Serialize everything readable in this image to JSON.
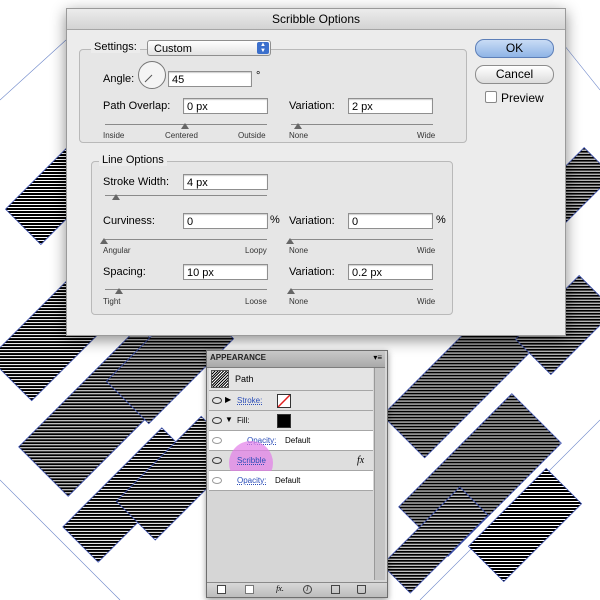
{
  "dialog": {
    "title": "Scribble Options",
    "settings_label": "Settings:",
    "settings_value": "Custom",
    "angle_label": "Angle:",
    "angle_value": "45",
    "angle_unit": "°",
    "path_overlap_label": "Path Overlap:",
    "path_overlap_value": "0 px",
    "path_overlap_variation_label": "Variation:",
    "path_overlap_variation_value": "2 px",
    "path_overlap_ticks": [
      "Inside",
      "Centered",
      "Outside"
    ],
    "path_overlap_variation_ticks": [
      "None",
      "Wide"
    ],
    "line_options_title": "Line Options",
    "stroke_width_label": "Stroke Width:",
    "stroke_width_value": "4 px",
    "curviness_label": "Curviness:",
    "curviness_value": "0",
    "curviness_unit": "%",
    "curviness_ticks": [
      "Angular",
      "Loopy"
    ],
    "curviness_variation_label": "Variation:",
    "curviness_variation_value": "0",
    "curviness_variation_unit": "%",
    "curviness_variation_ticks": [
      "None",
      "Wide"
    ],
    "spacing_label": "Spacing:",
    "spacing_value": "10 px",
    "spacing_ticks": [
      "Tight",
      "Loose"
    ],
    "spacing_variation_label": "Variation:",
    "spacing_variation_value": "0.2 px",
    "spacing_variation_ticks": [
      "None",
      "Wide"
    ],
    "ok_label": "OK",
    "cancel_label": "Cancel",
    "preview_label": "Preview",
    "accent_color": "#3b6fcc"
  },
  "appearance": {
    "tab_label": "APPEARANCE",
    "path_label": "Path",
    "stroke_label": "Stroke:",
    "fill_label": "Fill:",
    "fill_opacity_label": "Opacity:",
    "fill_opacity_value": "Default",
    "scribble_label": "Scribble",
    "fx_symbol": "fx",
    "opacity_label": "Opacity:",
    "opacity_value": "Default",
    "highlight_color": "#e27ee8",
    "fill_color": "#000000",
    "stroke_color": "none"
  }
}
